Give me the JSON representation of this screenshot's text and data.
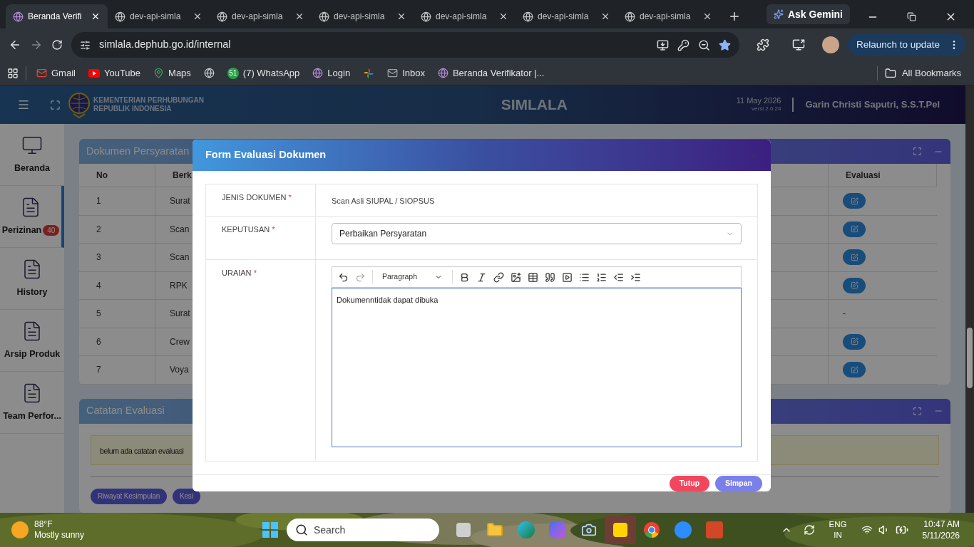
{
  "browser": {
    "tabs": [
      {
        "title": "Beranda Verifi",
        "selected": true
      },
      {
        "title": "dev-api-simla",
        "selected": false
      },
      {
        "title": "dev-api-simla",
        "selected": false
      },
      {
        "title": "dev-api-simla",
        "selected": false
      },
      {
        "title": "dev-api-simla",
        "selected": false
      },
      {
        "title": "dev-api-simla",
        "selected": false
      },
      {
        "title": "dev-api-simla",
        "selected": false
      }
    ],
    "gemini_button": "Ask Gemini",
    "url": "simlala.dephub.go.id/internal",
    "relaunch_button": "Relaunch to update",
    "bookmarks": [
      {
        "kind": "gmail",
        "label": "Gmail"
      },
      {
        "kind": "youtube",
        "label": "YouTube"
      },
      {
        "kind": "maps",
        "label": "Maps"
      },
      {
        "kind": "globe"
      },
      {
        "kind": "whatsapp",
        "badge": "51",
        "label": "(7) WhatsApp"
      },
      {
        "kind": "site",
        "label": "Login"
      },
      {
        "kind": "photos"
      },
      {
        "kind": "mail",
        "label": "Inbox"
      },
      {
        "kind": "site",
        "label": "Beranda Verifikator |..."
      }
    ],
    "all_bookmarks": "All Bookmarks"
  },
  "app_header": {
    "org_lines": [
      "KEMENTERIAN PERHUBUNGAN",
      "REPUBLIK INDONESIA"
    ],
    "title": "SIMLALA",
    "date": "11 May 2026",
    "version": "versi 2.0.24",
    "user": "Garin Christi Saputri, S.S.T.Pel"
  },
  "sidebar": {
    "items": [
      {
        "label": "Beranda",
        "kind": "monitor",
        "selected": false
      },
      {
        "label": "Perizinan",
        "badge": "40",
        "kind": "document",
        "selected": true
      },
      {
        "label": "History",
        "kind": "document",
        "selected": false
      },
      {
        "label": "Arsip Produk",
        "kind": "document",
        "selected": false
      },
      {
        "label": "Team Perfor...",
        "kind": "document",
        "selected": false
      }
    ]
  },
  "documents_card": {
    "title": "Dokumen Persyaratan",
    "columns": [
      "No",
      "Berk",
      "Evaluasi"
    ],
    "rows": [
      {
        "no": "1",
        "file": "Surat",
        "evaluation": {
          "kind": "button"
        }
      },
      {
        "no": "2",
        "file": "Scan",
        "evaluation": {
          "kind": "button"
        }
      },
      {
        "no": "3",
        "file": "Scan",
        "evaluation": {
          "kind": "button"
        }
      },
      {
        "no": "4",
        "file": "RPK",
        "evaluation": {
          "kind": "button"
        }
      },
      {
        "no": "5",
        "file": "Surat",
        "evaluation": {
          "kind": "text",
          "text": "-"
        }
      },
      {
        "no": "6",
        "file": "Crew",
        "evaluation": {
          "kind": "button"
        }
      },
      {
        "no": "7",
        "file": "Voya",
        "evaluation": {
          "kind": "button"
        }
      }
    ]
  },
  "notes_card": {
    "title": "Catatan Evaluasi",
    "message": "belum ada catatan evaluasi",
    "buttons": [
      "Riwayat Kesimpulan",
      "Kesi"
    ]
  },
  "modal": {
    "title": "Form Evaluasi Dokumen",
    "fields": [
      {
        "label": "JENIS DOKUMEN",
        "required_mark": "*",
        "kind": "text",
        "value": "Scan Asli SIUPAL / SIOPSUS"
      },
      {
        "label": "KEPUTUSAN",
        "required_mark": "*",
        "kind": "select",
        "value": "Perbaikan Persyaratan"
      },
      {
        "label": "URAIAN",
        "required_mark": "*",
        "kind": "editor",
        "block_format": "Paragraph",
        "value": "Dokumenntidak dapat dibuka"
      }
    ],
    "buttons": [
      {
        "label": "Tutup",
        "kind": "danger"
      },
      {
        "label": "Simpan",
        "kind": "primary"
      }
    ]
  },
  "taskbar": {
    "temperature": "88°F",
    "weather": "Mostly sunny",
    "search_placeholder": "Search",
    "apps": [
      {
        "kind": "taskview",
        "selected": false
      },
      {
        "kind": "explorer",
        "selected": false
      },
      {
        "kind": "edge",
        "selected": false
      },
      {
        "kind": "copilot",
        "selected": false
      },
      {
        "kind": "camera",
        "selected": false
      },
      {
        "kind": "notes",
        "selected": true
      },
      {
        "kind": "chrome",
        "selected": false
      },
      {
        "kind": "zoom",
        "selected": false
      },
      {
        "kind": "powerpoint",
        "selected": false
      }
    ],
    "language": [
      "ENG",
      "IN"
    ],
    "time": "10:47 AM",
    "date": "5/11/2026"
  }
}
